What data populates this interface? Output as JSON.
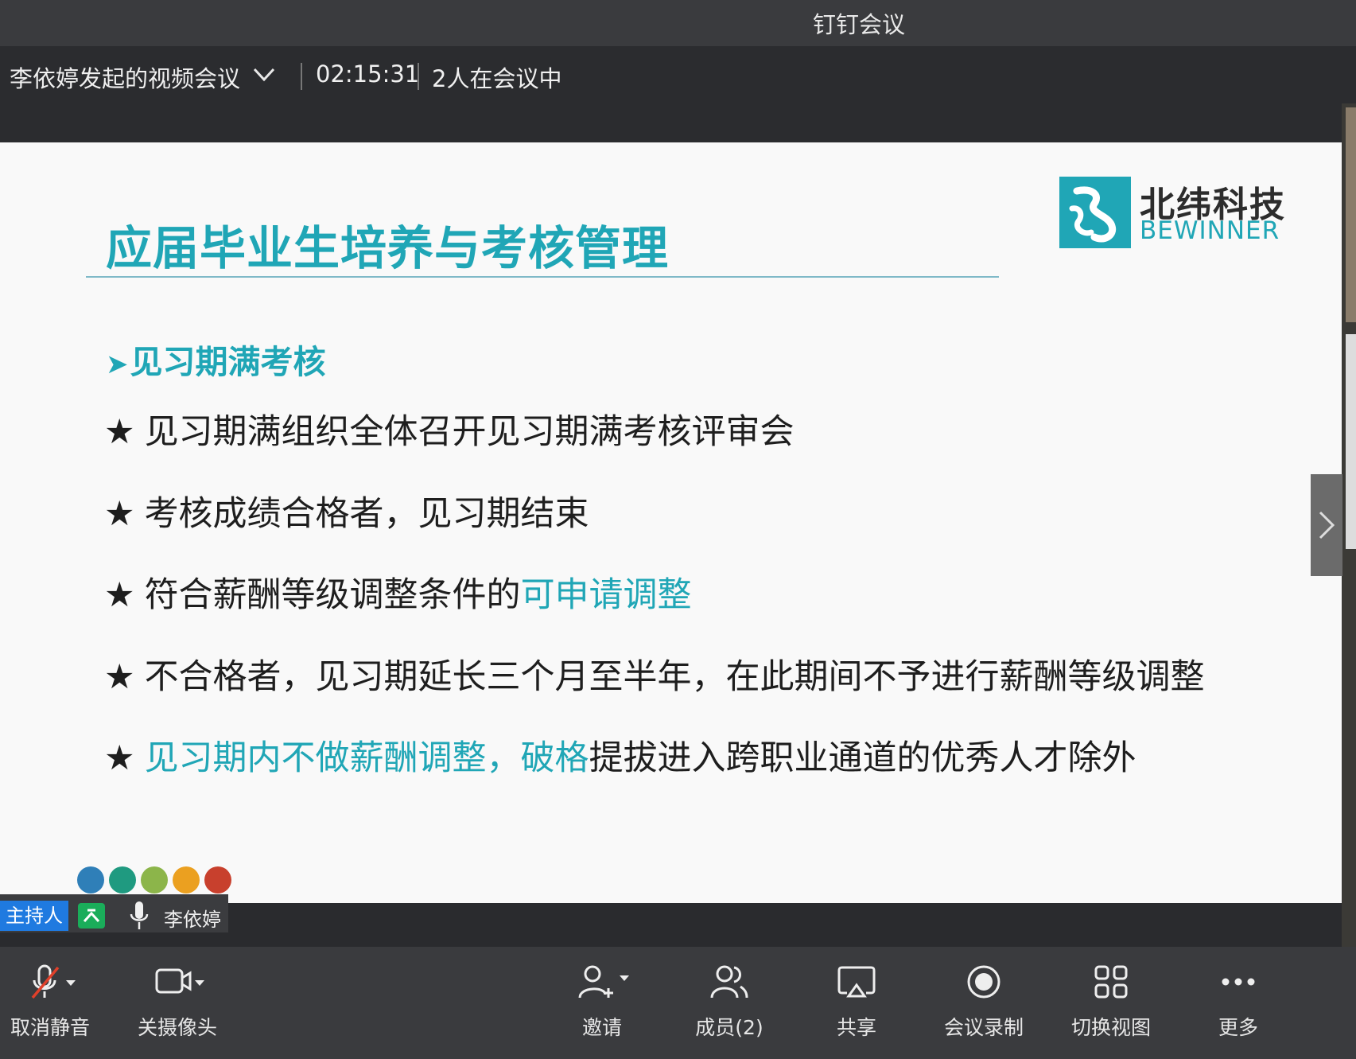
{
  "window": {
    "title": "钉钉会议"
  },
  "meeting": {
    "name": "李依婷发起的视频会议",
    "elapsed": "02:15:31",
    "participants_text": "2人在会议中"
  },
  "slide": {
    "title": "应届毕业生培养与考核管理",
    "logo_cn": "北纬科技",
    "logo_en": "BEWINNER",
    "section_heading": "见习期满考核",
    "star": "★",
    "bullets": [
      {
        "parts": [
          {
            "text": "见习期满组织全体召开见习期满考核评审会",
            "highlight": false
          }
        ]
      },
      {
        "parts": [
          {
            "text": "考核成绩合格者，见习期结束",
            "highlight": false
          }
        ]
      },
      {
        "parts": [
          {
            "text": "符合薪酬等级调整条件的",
            "highlight": false
          },
          {
            "text": "可申请调整",
            "highlight": true
          }
        ]
      },
      {
        "parts": [
          {
            "text": "不合格者，见习期延长三个月至半年，在此期间不予进行薪酬等级调整",
            "highlight": false
          }
        ]
      },
      {
        "parts": [
          {
            "text": "见习期内不做薪酬调整，破格",
            "highlight": true
          },
          {
            "text": "提拔进入跨职业通道的优秀人才除外",
            "highlight": false
          }
        ]
      }
    ],
    "dot_colors": [
      "#2f7fb8",
      "#1f9a80",
      "#8cb54a",
      "#eba020",
      "#c8402d"
    ],
    "accent_color": "#20a6b6"
  },
  "speaker": {
    "role_badge": "主持人",
    "name": "李依婷"
  },
  "toolbar": {
    "unmute": "取消静音",
    "camera_off": "关摄像头",
    "invite": "邀请",
    "members": "成员(2)",
    "share": "共享",
    "record": "会议录制",
    "switch_view": "切换视图",
    "more": "更多"
  }
}
